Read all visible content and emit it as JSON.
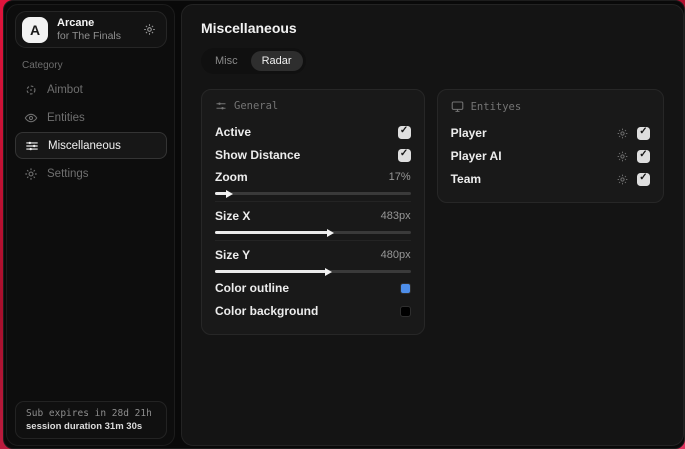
{
  "sidebar": {
    "brand": {
      "logo_letter": "A",
      "title": "Arcane",
      "subtitle": "for The Finals"
    },
    "category_label": "Category",
    "items": [
      {
        "label": "Aimbot"
      },
      {
        "label": "Entities"
      },
      {
        "label": "Miscellaneous"
      },
      {
        "label": "Settings"
      }
    ],
    "footer": {
      "line1": "Sub expires in 28d 21h",
      "line2": "session duration 31m 30s"
    }
  },
  "main": {
    "title": "Miscellaneous",
    "tabs": [
      {
        "label": "Misc",
        "active": false
      },
      {
        "label": "Radar",
        "active": true
      }
    ],
    "general_panel": {
      "title": "General",
      "toggles": [
        {
          "label": "Active",
          "checked": true
        },
        {
          "label": "Show Distance",
          "checked": true
        }
      ],
      "sliders": [
        {
          "label": "Zoom",
          "value": "17%",
          "fill_percent": 6
        },
        {
          "label": "Size X",
          "value": "483px",
          "fill_percent": 58
        },
        {
          "label": "Size Y",
          "value": "480px",
          "fill_percent": 57
        }
      ],
      "colors": [
        {
          "label": "Color outline",
          "swatch": "#4e8ee9"
        },
        {
          "label": "Color background",
          "swatch": "#000000"
        }
      ]
    },
    "entities_panel": {
      "title": "Entityes",
      "rows": [
        {
          "label": "Player",
          "checked": true
        },
        {
          "label": "Player AI",
          "checked": true
        },
        {
          "label": "Team",
          "checked": true
        }
      ]
    }
  }
}
